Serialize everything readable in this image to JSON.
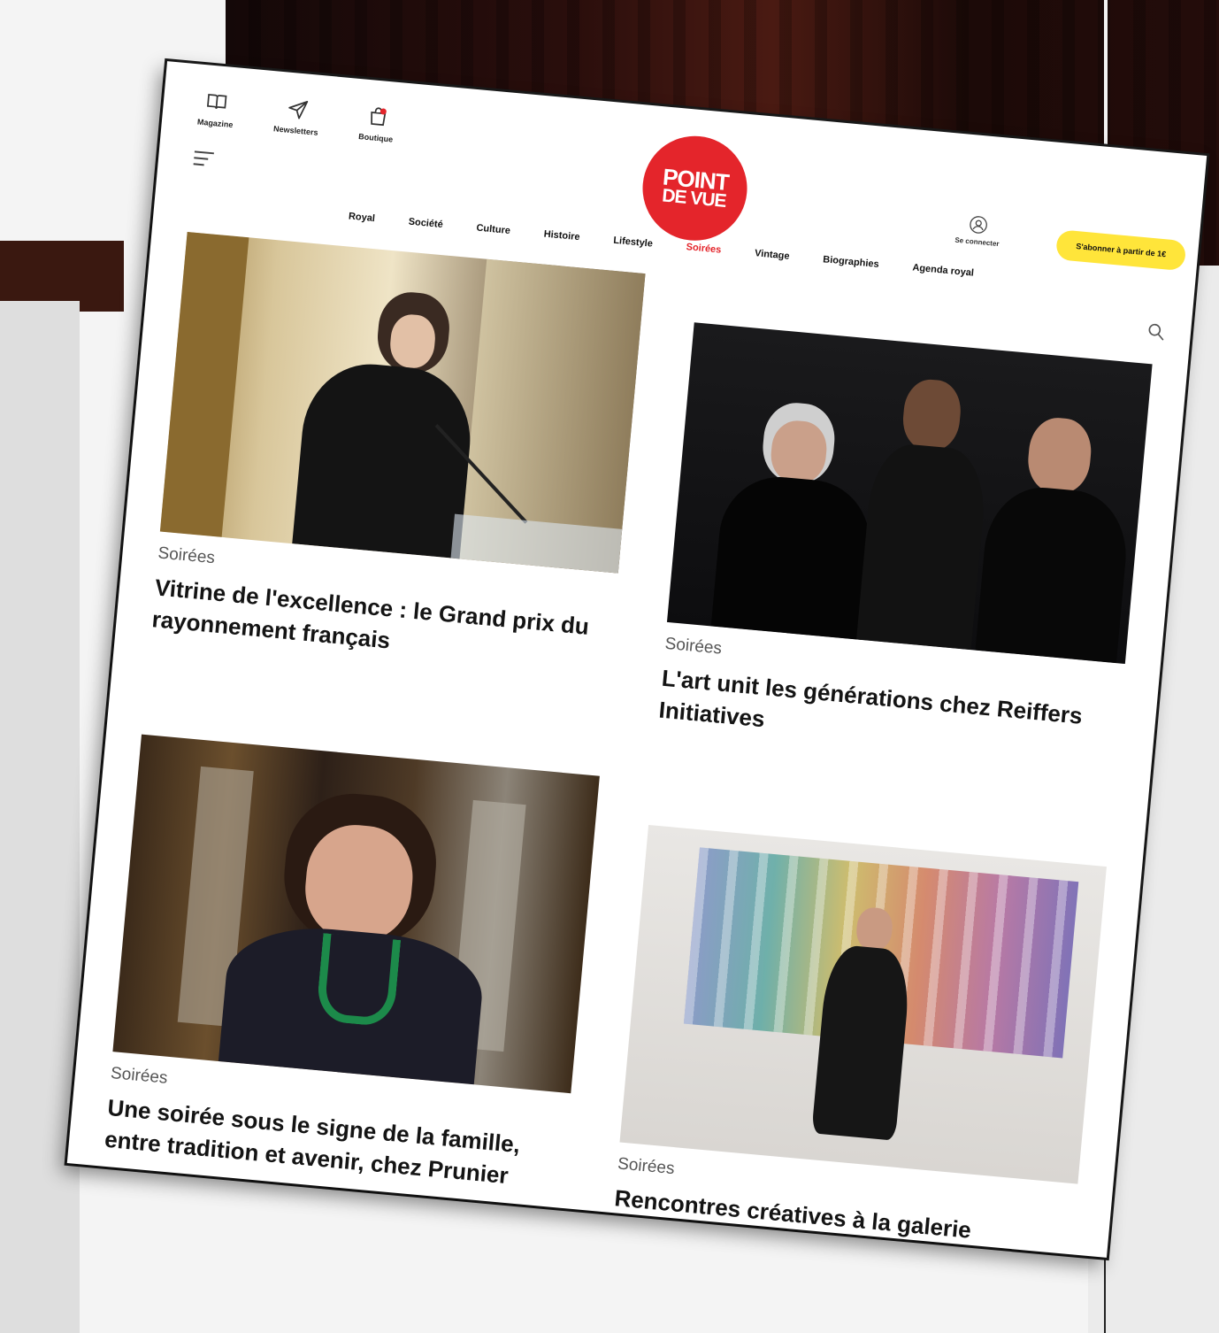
{
  "header": {
    "quick_links": [
      {
        "label": "Magazine",
        "icon": "book-icon"
      },
      {
        "label": "Newsletters",
        "icon": "send-icon"
      },
      {
        "label": "Boutique",
        "icon": "shopping-bag-icon"
      }
    ],
    "logo": {
      "line1": "POINT",
      "line2": "DE VUE"
    },
    "account_label": "Se connecter",
    "subscribe_label": "S'abonner à partir de 1€"
  },
  "nav": {
    "items": [
      {
        "label": "Royal"
      },
      {
        "label": "Société"
      },
      {
        "label": "Culture"
      },
      {
        "label": "Histoire"
      },
      {
        "label": "Lifestyle"
      },
      {
        "label": "Soirées",
        "active": true
      },
      {
        "label": "Vintage"
      },
      {
        "label": "Biographies"
      },
      {
        "label": "Agenda royal"
      }
    ]
  },
  "articles": [
    {
      "category": "Soirées",
      "title": "Vitrine de l'excellence : le Grand prix du rayonnement français"
    },
    {
      "category": "Soirées",
      "title": "L'art unit les générations chez Reiffers Initiatives"
    },
    {
      "category": "Soirées",
      "title": "Une soirée sous le signe de la famille, entre tradition et avenir, chez Prunier"
    },
    {
      "category": "Soirées",
      "title": "Rencontres créatives à la galerie Alexandre Biaggi"
    }
  ],
  "colors": {
    "brand_red": "#e4252b",
    "subscribe_yellow": "#ffe53a",
    "text_dark": "#141414"
  }
}
